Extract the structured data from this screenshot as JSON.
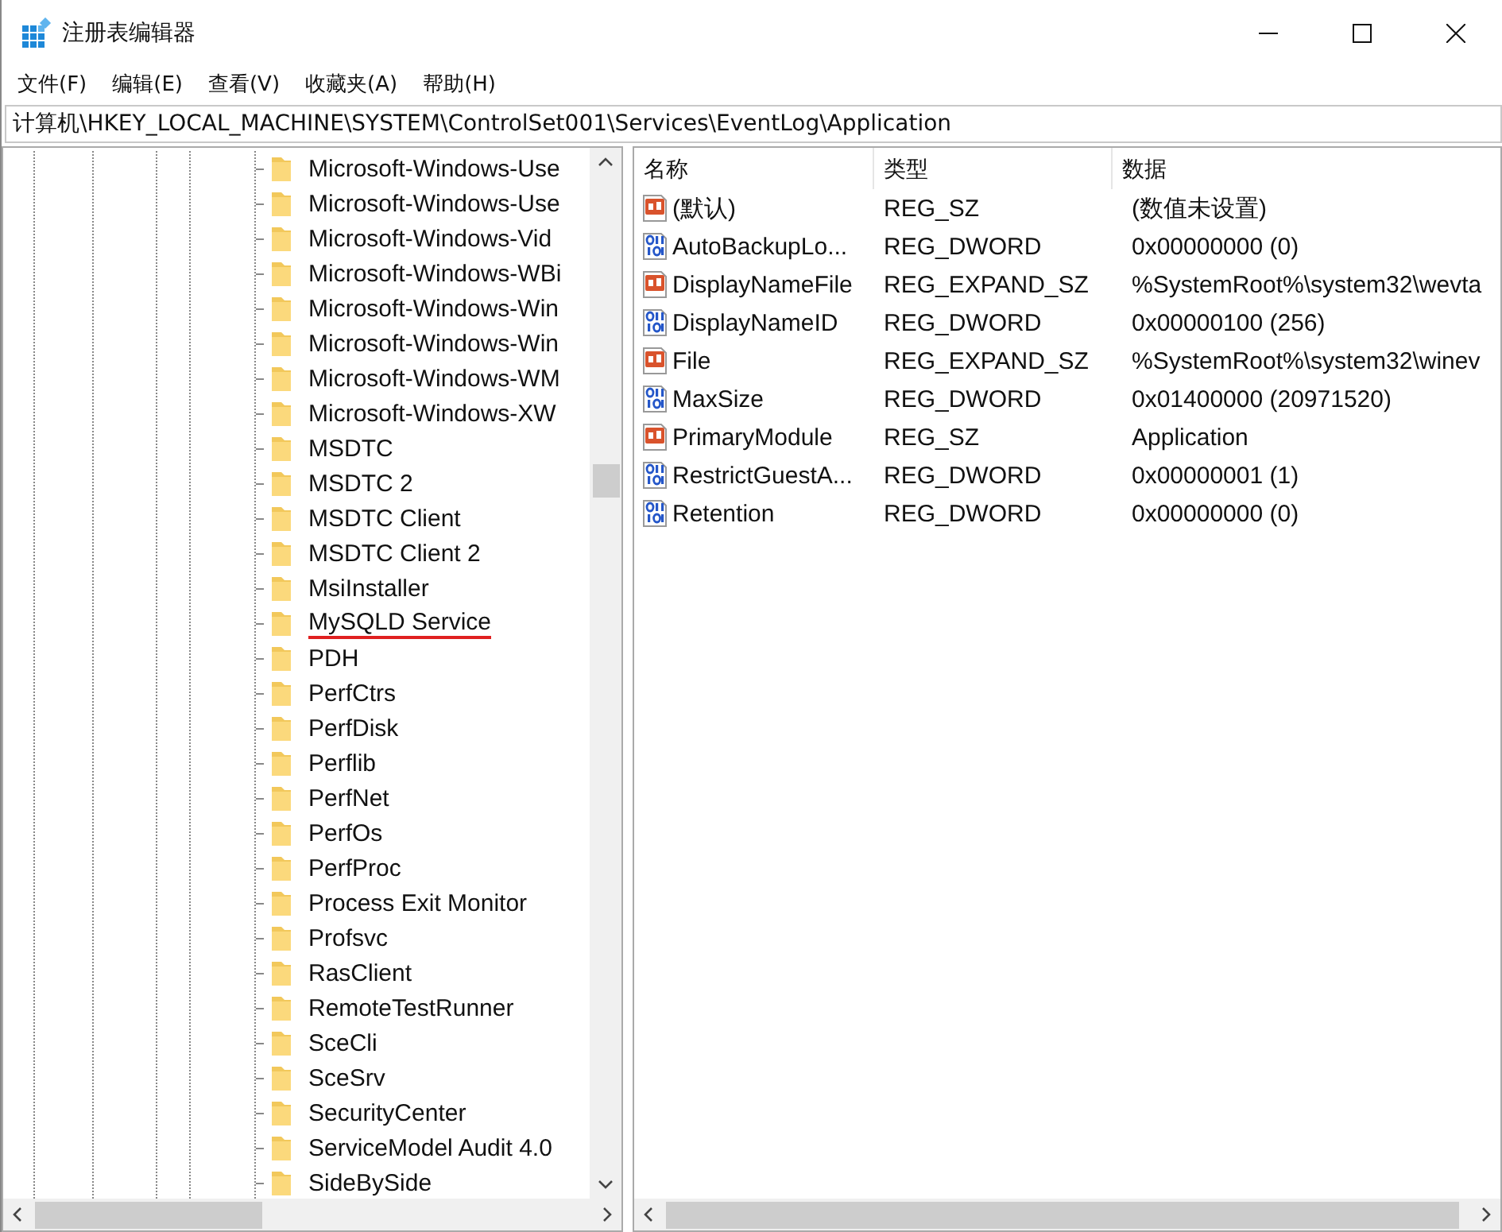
{
  "window": {
    "title": "注册表编辑器"
  },
  "menu": [
    "文件(F)",
    "编辑(E)",
    "查看(V)",
    "收藏夹(A)",
    "帮助(H)"
  ],
  "address": "计算机\\HKEY_LOCAL_MACHINE\\SYSTEM\\ControlSet001\\Services\\EventLog\\Application",
  "tree": {
    "items": [
      {
        "label": "Microsoft-Windows-Use",
        "underlined": false
      },
      {
        "label": "Microsoft-Windows-Use",
        "underlined": false
      },
      {
        "label": "Microsoft-Windows-Vid",
        "underlined": false
      },
      {
        "label": "Microsoft-Windows-WBi",
        "underlined": false
      },
      {
        "label": "Microsoft-Windows-Win",
        "underlined": false
      },
      {
        "label": "Microsoft-Windows-Win",
        "underlined": false
      },
      {
        "label": "Microsoft-Windows-WM",
        "underlined": false
      },
      {
        "label": "Microsoft-Windows-XW",
        "underlined": false
      },
      {
        "label": "MSDTC",
        "underlined": false
      },
      {
        "label": "MSDTC 2",
        "underlined": false
      },
      {
        "label": "MSDTC Client",
        "underlined": false
      },
      {
        "label": "MSDTC Client 2",
        "underlined": false
      },
      {
        "label": "MsiInstaller",
        "underlined": false
      },
      {
        "label": "MySQLD Service",
        "underlined": true
      },
      {
        "label": "PDH",
        "underlined": false
      },
      {
        "label": "PerfCtrs",
        "underlined": false
      },
      {
        "label": "PerfDisk",
        "underlined": false
      },
      {
        "label": "Perflib",
        "underlined": false
      },
      {
        "label": "PerfNet",
        "underlined": false
      },
      {
        "label": "PerfOs",
        "underlined": false
      },
      {
        "label": "PerfProc",
        "underlined": false
      },
      {
        "label": "Process Exit Monitor",
        "underlined": false
      },
      {
        "label": "Profsvc",
        "underlined": false
      },
      {
        "label": "RasClient",
        "underlined": false
      },
      {
        "label": "RemoteTestRunner",
        "underlined": false
      },
      {
        "label": "SceCli",
        "underlined": false
      },
      {
        "label": "SceSrv",
        "underlined": false
      },
      {
        "label": "SecurityCenter",
        "underlined": false
      },
      {
        "label": "ServiceModel Audit 4.0",
        "underlined": false
      },
      {
        "label": "SideBySide",
        "underlined": false
      }
    ]
  },
  "table": {
    "columns": [
      "名称",
      "类型",
      "数据"
    ],
    "rows": [
      {
        "kind": "string",
        "name": "(默认)",
        "type": "REG_SZ",
        "data": "(数值未设置)"
      },
      {
        "kind": "dword",
        "name": "AutoBackupLo...",
        "type": "REG_DWORD",
        "data": "0x00000000 (0)"
      },
      {
        "kind": "string",
        "name": "DisplayNameFile",
        "type": "REG_EXPAND_SZ",
        "data": "%SystemRoot%\\system32\\wevta"
      },
      {
        "kind": "dword",
        "name": "DisplayNameID",
        "type": "REG_DWORD",
        "data": "0x00000100 (256)"
      },
      {
        "kind": "string",
        "name": "File",
        "type": "REG_EXPAND_SZ",
        "data": "%SystemRoot%\\system32\\winev"
      },
      {
        "kind": "dword",
        "name": "MaxSize",
        "type": "REG_DWORD",
        "data": "0x01400000 (20971520)"
      },
      {
        "kind": "string",
        "name": "PrimaryModule",
        "type": "REG_SZ",
        "data": "Application"
      },
      {
        "kind": "dword",
        "name": "RestrictGuestA...",
        "type": "REG_DWORD",
        "data": "0x00000001 (1)"
      },
      {
        "kind": "dword",
        "name": "Retention",
        "type": "REG_DWORD",
        "data": "0x00000000 (0)"
      }
    ]
  }
}
